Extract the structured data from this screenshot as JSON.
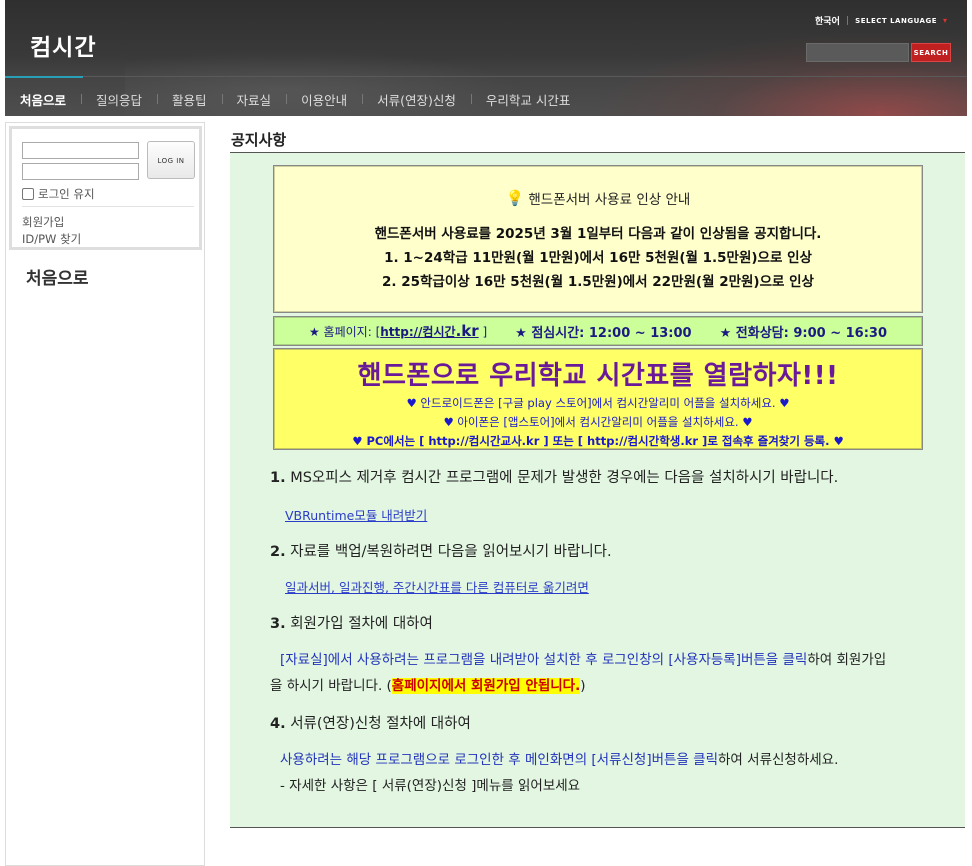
{
  "header": {
    "logo": "컴시간",
    "lang_current": "한국어",
    "lang_select": "SELECT LANGUAGE",
    "lang_chevron": "▾",
    "search_button": "SEARCH",
    "nav": [
      "처음으로",
      "질의응답",
      "활용팁",
      "자료실",
      "이용안내",
      "서류(연장)신청",
      "우리학교 시간표"
    ]
  },
  "sidebar": {
    "login_button": "LOG IN",
    "keep_login": "로그인 유지",
    "signup": "회원가입",
    "find_id": "ID/PW 찾기",
    "title": "처음으로"
  },
  "main": {
    "title": "공지사항",
    "notice": {
      "title": "핸드폰서버 사용료 인상 안내",
      "line1": "핸드폰서버 사용료를 2025년 3월 1일부터 다음과 같이 인상됨을 공지합니다.",
      "line2": "1. 1~24학급 11만원(월 1만원)에서 16만 5천원(월 1.5만원)으로 인상",
      "line3": "2. 25학급이상 16만 5천원(월 1.5만원)에서 22만원(월 2만원)으로 인상"
    },
    "info": {
      "homepage_label": "★ 홈페이지: [",
      "homepage_link": "http://컴시간",
      "homepage_kr": ".kr",
      "homepage_end": " ]",
      "lunch": "★ 점심시간: 12:00 ~ 13:00",
      "phone": "★ 전화상담: 9:00 ~ 16:30"
    },
    "promo": {
      "title": "핸드폰으로 우리학교 시간표를 열람하자!!!",
      "android": "♥ 안드로이드폰은 [구글 play 스토어]에서 컴시간알리미 어플을 설치하세요. ♥",
      "iphone": "♥ 아이폰은 [앱스토어]에서 컴시간알리미 어플을 설치하세요. ♥",
      "pc": "♥ PC에서는 [ http://컴시간교사.kr ] 또는 [ http://컴시간학생.kr ]로 접속후 즐겨찾기 등록. ♥"
    },
    "section1": {
      "num": "1.",
      "text": "MS오피스 제거후 컴시간 프로그램에 문제가 발생한 경우에는 다음을 설치하시기 바랍니다.",
      "link": "VBRuntime모듈 내려받기"
    },
    "section2": {
      "num": "2.",
      "text": "자료를 백업/복원하려면 다음을 읽어보시기 바랍니다.",
      "link": "일과서버, 일과진행, 주간시간표를 다른 컴퓨터로 옮기려면"
    },
    "section3": {
      "num": "3.",
      "text": "회원가입 절차에 대하여",
      "body_blue": "[자료실]에서 사용하려는 프로그램을 내려받아 설치한 후 로그인창의 [사용자등록]버튼을 클릭",
      "body_rest": "하여 회원가입",
      "body_line2": "을 하시기 바랍니다. (",
      "highlight": "홈페이지에서 회원가입 안됩니다.",
      "body_end": ")"
    },
    "section4": {
      "num": "4.",
      "text": "서류(연장)신청 절차에 대하여",
      "body_blue": "사용하려는 해당 프로그램으로 로그인한 후 메인화면의 [서류신청]버튼을 클릭",
      "body_rest": "하여 서류신청하세요.",
      "body_line2": "- 자세한 사항은 [ 서류(연장)신청 ]메뉴를 읽어보세요"
    }
  }
}
